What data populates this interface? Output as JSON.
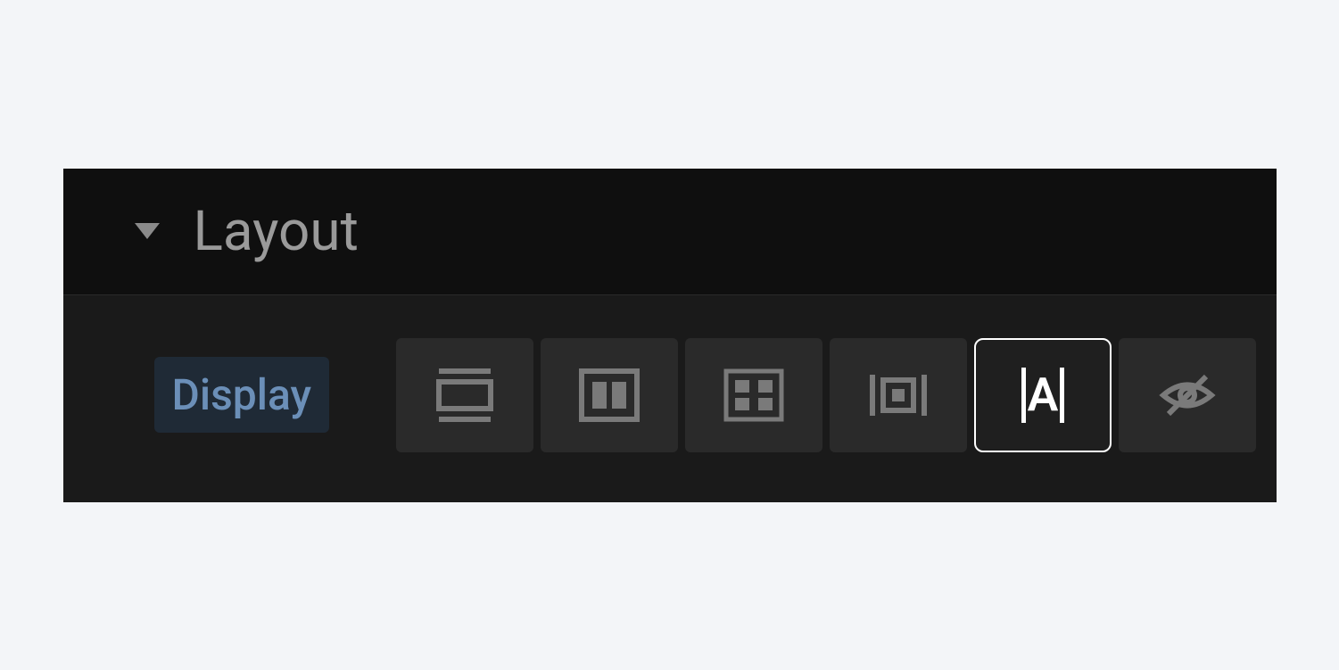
{
  "panel": {
    "title": "Layout",
    "property_label": "Display",
    "options": [
      {
        "name": "block",
        "icon": "block-icon",
        "selected": false
      },
      {
        "name": "flex",
        "icon": "flex-icon",
        "selected": false
      },
      {
        "name": "grid",
        "icon": "grid-icon",
        "selected": false
      },
      {
        "name": "inline-block",
        "icon": "inline-block-icon",
        "selected": false
      },
      {
        "name": "inline",
        "icon": "inline-icon",
        "selected": true,
        "letter": "A"
      },
      {
        "name": "none",
        "icon": "none-icon",
        "selected": false
      }
    ]
  }
}
